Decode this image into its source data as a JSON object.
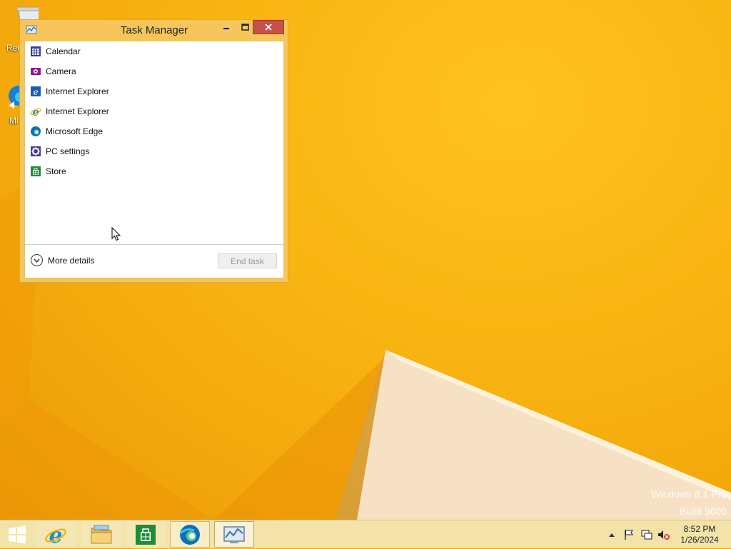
{
  "desktop": {
    "icons": [
      {
        "label": "Rec",
        "icon": "recycle-bin-icon"
      },
      {
        "label": "Mi",
        "icon": "edge-shortcut-icon"
      }
    ],
    "watermark": {
      "line1": "Windows 8.1 Pro",
      "line2": "Build 9600"
    }
  },
  "task_manager": {
    "title": "Task Manager",
    "apps": [
      {
        "label": "Calendar",
        "icon": "calendar-icon"
      },
      {
        "label": "Camera",
        "icon": "camera-icon"
      },
      {
        "label": "Internet Explorer",
        "icon": "ie-modern-icon"
      },
      {
        "label": "Internet Explorer",
        "icon": "ie-icon"
      },
      {
        "label": "Microsoft Edge",
        "icon": "edge-icon"
      },
      {
        "label": "PC settings",
        "icon": "gear-icon"
      },
      {
        "label": "Store",
        "icon": "store-icon"
      }
    ],
    "more_details_label": "More details",
    "end_task_label": "End task"
  },
  "taskbar": {
    "items": [
      {
        "icon": "internet-explorer-icon",
        "state": "pinned"
      },
      {
        "icon": "file-explorer-icon",
        "state": "pinned"
      },
      {
        "icon": "store-icon",
        "state": "pinned"
      },
      {
        "icon": "edge-icon",
        "state": "running"
      },
      {
        "icon": "task-manager-icon",
        "state": "active"
      }
    ],
    "tray_icons": [
      "show-hidden-icons-icon",
      "action-center-flag-icon",
      "network-icon",
      "volume-muted-icon"
    ],
    "clock": {
      "time": "8:52 PM",
      "date": "1/26/2024"
    }
  },
  "colors": {
    "desktop_accent": "#f7ad0a",
    "window_frame": "#f6c65a",
    "close_button": "#c7504a",
    "taskbar": "#f3e3a9"
  }
}
